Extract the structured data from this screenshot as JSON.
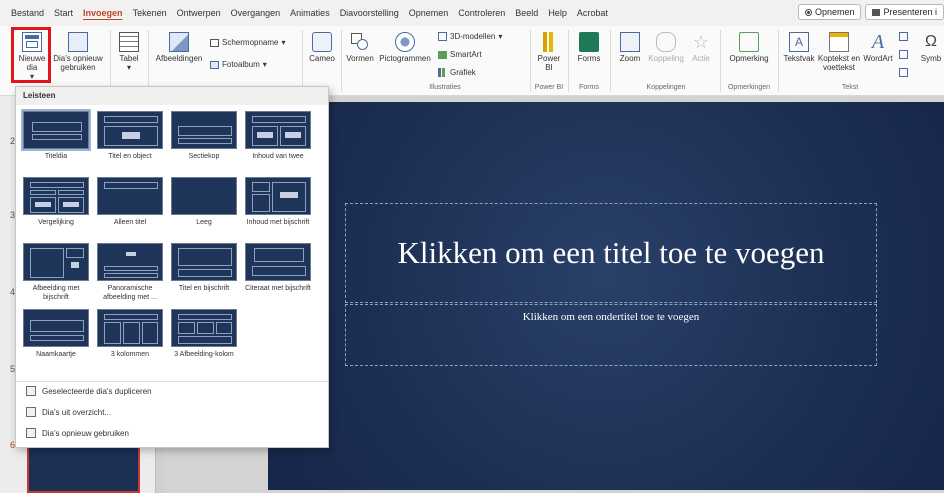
{
  "menubar": {
    "items": [
      "Bestand",
      "Start",
      "Invoegen",
      "Tekenen",
      "Ontwerpen",
      "Overgangen",
      "Animaties",
      "Diavoorstelling",
      "Opnemen",
      "Controleren",
      "Beeld",
      "Help",
      "Acrobat"
    ],
    "active_index": 2,
    "record_button": "Opnemen",
    "present_button": "Presenteren i"
  },
  "ribbon": {
    "new_slide": "Nieuwe dia",
    "reuse_slides": "Dia's opnieuw gebruiken",
    "table": "Tabel",
    "images": "Afbeeldingen",
    "screenshot": "Schermopname",
    "photo_album": "Fotoalbum",
    "cameo": "Cameo",
    "shapes": "Vormen",
    "icons": "Pictogrammen",
    "models_3d": "3D-modellen",
    "smartart": "SmartArt",
    "chart": "Grafiek",
    "powerbi": "Power BI",
    "forms": "Forms",
    "zoom": "Zoom",
    "link": "Koppeling",
    "action": "Actie",
    "comment": "Opmerking",
    "textbox": "Tekstvak",
    "header_footer": "Koptekst en voettekst",
    "wordart": "WordArt",
    "symbols": "Symb",
    "groups": {
      "illustrations": "Illustraties",
      "powerbi": "Power BI",
      "forms": "Forms",
      "links": "Koppelingen",
      "comments": "Opmerkingen",
      "text": "Tekst"
    }
  },
  "thumbnails": {
    "numbers": [
      "2",
      "3",
      "4",
      "5",
      "6"
    ]
  },
  "slide": {
    "title": "Klikken om een titel toe te voegen",
    "subtitle": "Klikken om een ondertitel toe te voegen"
  },
  "dropdown": {
    "header": "Leisteen",
    "layouts": [
      {
        "name": "Titeldia"
      },
      {
        "name": "Titel en object"
      },
      {
        "name": "Sectiekop"
      },
      {
        "name": "Inhoud van twee"
      },
      {
        "name": "Vergelijking"
      },
      {
        "name": "Alleen titel"
      },
      {
        "name": "Leeg"
      },
      {
        "name": "Inhoud met bijschrift"
      },
      {
        "name": "Afbeelding met bijschrift"
      },
      {
        "name": "Panoramische afbeelding met ..."
      },
      {
        "name": "Titel en bijschrift"
      },
      {
        "name": "Citeraat met bijschrift"
      },
      {
        "name": "Naamkaartje"
      },
      {
        "name": "3 kolommen"
      },
      {
        "name": "3 Afbeelding-kolom"
      }
    ],
    "actions": {
      "duplicate": "Geselecteerde dia's dupliceren",
      "outline": "Dia's uit overzicht...",
      "reuse": "Dia's opnieuw gebruiken"
    }
  },
  "colors": {
    "accent": "#b7472a",
    "slide_bg": "#1d3156",
    "highlight": "#e3141c"
  }
}
